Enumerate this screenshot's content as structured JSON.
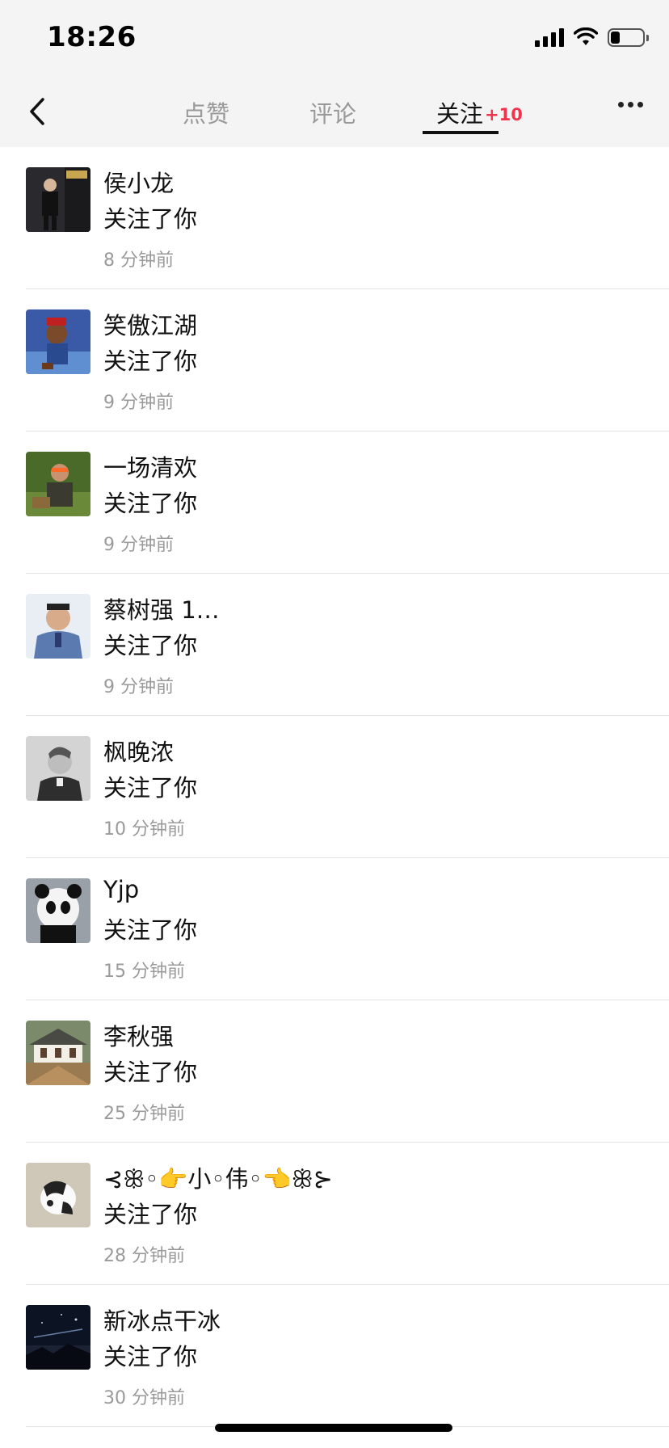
{
  "status_bar": {
    "time": "18:26"
  },
  "nav": {
    "back_icon": "chevron-left-icon",
    "tabs": [
      {
        "label": "点赞",
        "active": false
      },
      {
        "label": "评论",
        "active": false
      },
      {
        "label": "关注",
        "active": true,
        "badge": "+10"
      }
    ],
    "more_icon": "more-horizontal-icon"
  },
  "items": [
    {
      "name": "侯小龙",
      "action": "关注了你",
      "time": "8 分钟前"
    },
    {
      "name": "笑傲江湖",
      "action": "关注了你",
      "time": "9 分钟前"
    },
    {
      "name": "一场清欢",
      "action": "关注了你",
      "time": "9 分钟前"
    },
    {
      "name": "蔡树强 1…",
      "action": "关注了你",
      "time": "9 分钟前"
    },
    {
      "name": "枫晚浓",
      "action": "关注了你",
      "time": "10 分钟前"
    },
    {
      "name": "Yjp",
      "action": "关注了你",
      "time": "15 分钟前"
    },
    {
      "name": "李秋强",
      "action": "关注了你",
      "time": "25 分钟前"
    },
    {
      "name": "⊰ꕥ◦👉小◦伟◦👈ꕥ⊱",
      "action": "关注了你",
      "time": "28 分钟前"
    },
    {
      "name": "新冰点干冰",
      "action": "关注了你",
      "time": "30 分钟前"
    }
  ],
  "colors": {
    "badge": "#f0344d",
    "header_bg": "#f4f4f4",
    "time_text": "#9a9a9a"
  }
}
